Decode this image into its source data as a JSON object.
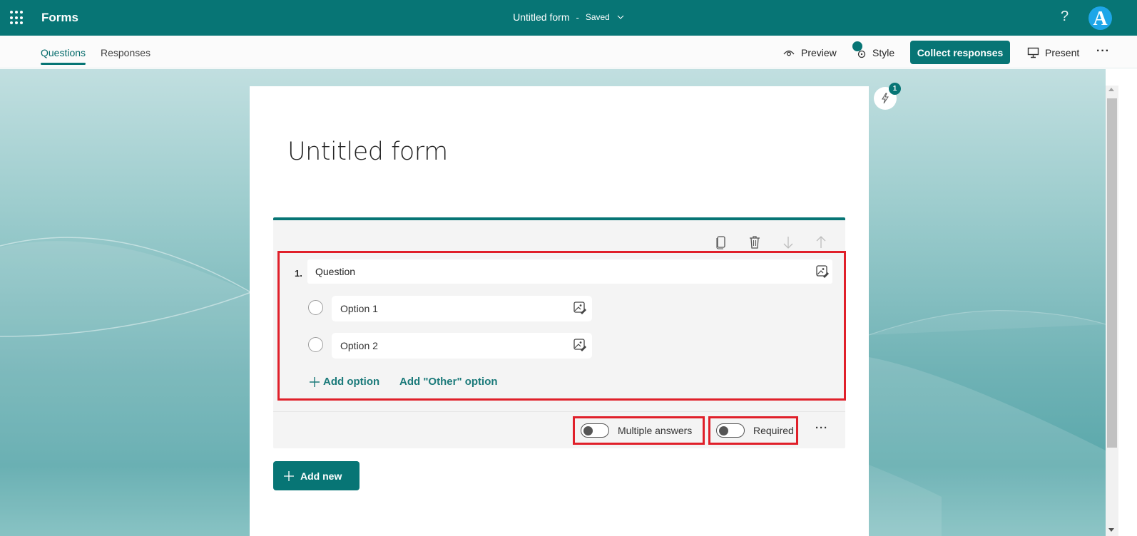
{
  "app": {
    "name": "Forms",
    "doc_title": "Untitled form",
    "separator": "-",
    "save_status": "Saved",
    "help_label": "?",
    "avatar_initial": "A"
  },
  "tabs": [
    {
      "label": "Questions",
      "active": true
    },
    {
      "label": "Responses",
      "active": false
    }
  ],
  "commands": {
    "preview": "Preview",
    "style": "Style",
    "collect": "Collect responses",
    "present": "Present",
    "more": "···"
  },
  "ideas": {
    "badge_count": "1"
  },
  "form": {
    "title": "Untitled form",
    "question": {
      "number": "1.",
      "text": "Question",
      "options": [
        {
          "label": "Option 1"
        },
        {
          "label": "Option 2"
        }
      ],
      "add_option": "Add option",
      "add_other": "Add \"Other\" option",
      "multiple_answers": {
        "label": "Multiple answers",
        "on": false
      },
      "required": {
        "label": "Required",
        "on": false
      },
      "more": "···"
    },
    "add_new": "Add new"
  },
  "colors": {
    "brand": "#077575",
    "highlight": "#e0202a",
    "avatar": "#1ea6e8"
  }
}
